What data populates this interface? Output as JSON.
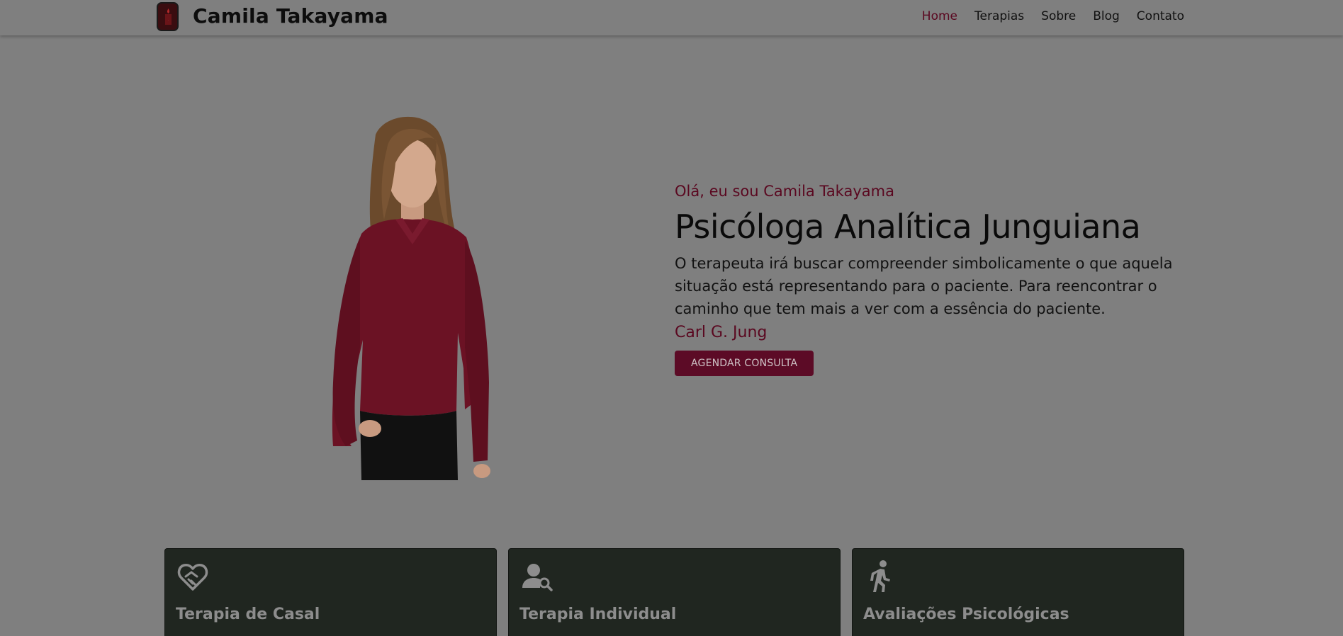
{
  "header": {
    "brand": "Camila Takayama",
    "logo_icon": "candle-logo-icon",
    "nav": [
      {
        "label": "Home",
        "active": true
      },
      {
        "label": "Terapias",
        "active": false
      },
      {
        "label": "Sobre",
        "active": false
      },
      {
        "label": "Blog",
        "active": false
      },
      {
        "label": "Contato",
        "active": false
      }
    ]
  },
  "hero": {
    "greeting": "Olá, eu sou Camila Takayama",
    "headline": "Psicóloga Analítica Junguiana",
    "quote": "O terapeuta irá buscar compreender simbolicamente o que aquela situação está representando para o paciente. Para reencontrar o caminho que tem mais a ver com a essência do paciente.",
    "author": "Carl G. Jung",
    "cta_label": "AGENDAR CONSULTA"
  },
  "cards": [
    {
      "title": "Terapia de Casal",
      "icon": "heart-handshake-icon"
    },
    {
      "title": "Terapia Individual",
      "icon": "user-search-icon"
    },
    {
      "title": "Avaliações Psicológicas",
      "icon": "walking-person-icon"
    }
  ],
  "colors": {
    "overlay_bg": "#7f7f7f",
    "accent": "#5a0820",
    "card_bg": "#202620"
  }
}
